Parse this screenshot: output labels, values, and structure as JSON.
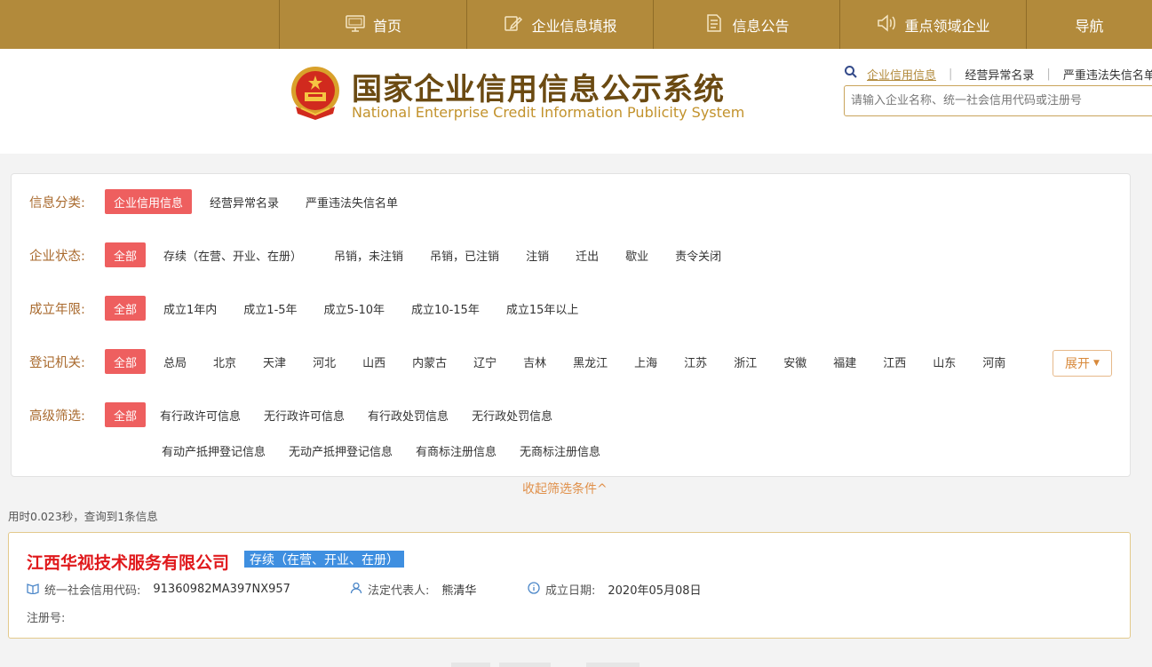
{
  "nav": {
    "items": [
      {
        "label": "首页",
        "icon": "monitor-icon"
      },
      {
        "label": "企业信息填报",
        "icon": "edit-icon"
      },
      {
        "label": "信息公告",
        "icon": "document-icon"
      },
      {
        "label": "重点领域企业",
        "icon": "speaker-icon"
      },
      {
        "label": "导航",
        "icon": ""
      }
    ]
  },
  "header": {
    "title_cn": "国家企业信用信息公示系统",
    "title_en": "National Enterprise Credit Information Publicity System"
  },
  "search": {
    "tabs": [
      "企业信用信息",
      "经营异常名录",
      "严重违法失信名单"
    ],
    "active_tab": "企业信用信息",
    "placeholder": "请输入企业名称、统一社会信用代码或注册号"
  },
  "filters": {
    "category": {
      "label": "信息分类:",
      "options": [
        "企业信用信息",
        "经营异常名录",
        "严重违法失信名单"
      ]
    },
    "status": {
      "label": "企业状态:",
      "options": [
        "全部",
        "存续（在营、开业、在册）",
        "吊销，未注销",
        "吊销，已注销",
        "注销",
        "迁出",
        "歇业",
        "责令关闭"
      ]
    },
    "age": {
      "label": "成立年限:",
      "options": [
        "全部",
        "成立1年内",
        "成立1-5年",
        "成立5-10年",
        "成立10-15年",
        "成立15年以上"
      ]
    },
    "authority": {
      "label": "登记机关:",
      "options": [
        "全部",
        "总局",
        "北京",
        "天津",
        "河北",
        "山西",
        "内蒙古",
        "辽宁",
        "吉林",
        "黑龙江",
        "上海",
        "江苏",
        "浙江",
        "安徽",
        "福建",
        "江西",
        "山东",
        "河南"
      ],
      "expand_label": "展开"
    },
    "advanced": {
      "label": "高级筛选:",
      "row1": [
        "全部",
        "有行政许可信息",
        "无行政许可信息",
        "有行政处罚信息",
        "无行政处罚信息"
      ],
      "row2": [
        "有动产抵押登记信息",
        "无动产抵押登记信息",
        "有商标注册信息",
        "无商标注册信息"
      ]
    },
    "collapse_label": "收起筛选条件^"
  },
  "stats": "用时0.023秒，查询到1条信息",
  "result": {
    "name": "江西华视技术服务有限公司",
    "status": "存续（在营、开业、在册）",
    "credit_code_label": "统一社会信用代码:",
    "credit_code": "91360982MA397NX957",
    "legal_rep_label": "法定代表人:",
    "legal_rep": "熊清华",
    "founded_label": "成立日期:",
    "founded": "2020年05月08日",
    "reg_no_label": "注册号:"
  },
  "colors": {
    "nav_bg": "#b28a3b",
    "active_chip": "#ee5f5f",
    "company_name": "#e0191c",
    "status_badge": "#3f8fe0"
  }
}
